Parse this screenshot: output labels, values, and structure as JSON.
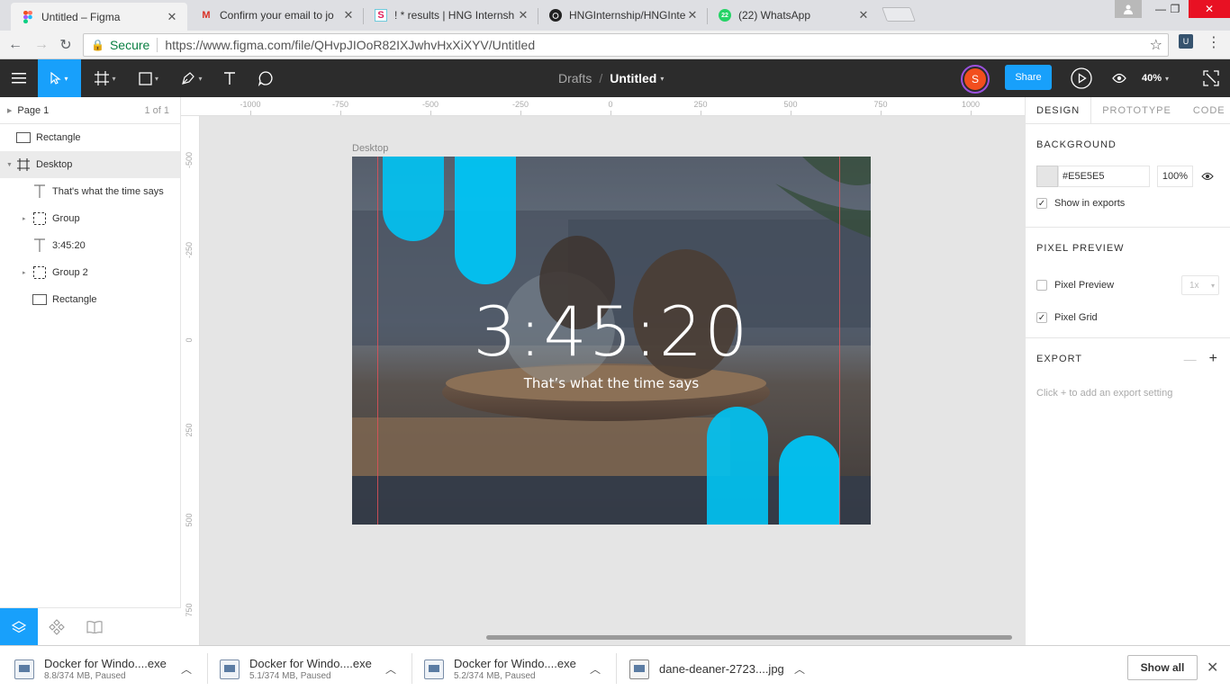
{
  "browser": {
    "tabs": [
      {
        "title": "Untitled – Figma",
        "icon": "figma-icon"
      },
      {
        "title": "Confirm your email to jo",
        "icon": "gmail-icon"
      },
      {
        "title": "! * results | HNG Internsh",
        "icon": "slack-icon"
      },
      {
        "title": "HNGInternship/HNGInte",
        "icon": "github-icon"
      },
      {
        "title": "(22) WhatsApp",
        "icon": "whatsapp-icon",
        "badge": "22"
      }
    ],
    "secure_label": "Secure",
    "url": "https://www.figma.com/file/QHvpJIOoR82IXJwhvHxXiXYV/Untitled",
    "extension_label": "U"
  },
  "toolbar": {
    "breadcrumb_parent": "Drafts",
    "breadcrumb_sep": "/",
    "file_name": "Untitled",
    "avatar_initial": "S",
    "share_label": "Share",
    "zoom": "40%"
  },
  "layers": {
    "page_name": "Page 1",
    "page_count": "1 of 1",
    "items": [
      {
        "name": "Rectangle",
        "type": "rect"
      },
      {
        "name": "Desktop",
        "type": "frame"
      },
      {
        "name": "That's what the time says",
        "type": "text"
      },
      {
        "name": "Group",
        "type": "group"
      },
      {
        "name": "3:45:20",
        "type": "text"
      },
      {
        "name": "Group 2",
        "type": "group"
      },
      {
        "name": "Rectangle",
        "type": "rect"
      }
    ]
  },
  "rulers": {
    "top": [
      "-1000",
      "-750",
      "-500",
      "-250",
      "0",
      "250",
      "500",
      "750",
      "1000"
    ],
    "left": [
      "-500",
      "-250",
      "0",
      "250",
      "500",
      "750"
    ]
  },
  "canvas": {
    "frame_label": "Desktop",
    "clock_text": "3:45:20",
    "tagline": "That’s what the time says",
    "accent": "#00c4f4"
  },
  "properties": {
    "tabs": [
      "DESIGN",
      "PROTOTYPE",
      "CODE"
    ],
    "background_title": "BACKGROUND",
    "bg_hex": "#E5E5E5",
    "bg_opacity": "100%",
    "show_in_exports": "Show in exports",
    "pixel_preview_title": "PIXEL PREVIEW",
    "pixel_preview_label": "Pixel Preview",
    "scale": "1x",
    "pixel_grid_label": "Pixel Grid",
    "export_title": "EXPORT",
    "export_hint": "Click + to add an export setting",
    "help": "?"
  },
  "downloads": {
    "items": [
      {
        "name": "Docker for Windo....exe",
        "status": "8.8/374 MB, Paused"
      },
      {
        "name": "Docker for Windo....exe",
        "status": "5.1/374 MB, Paused"
      },
      {
        "name": "Docker for Windo....exe",
        "status": "5.2/374 MB, Paused"
      },
      {
        "name": "dane-deaner-2723....jpg",
        "status": ""
      }
    ],
    "show_all": "Show all"
  }
}
